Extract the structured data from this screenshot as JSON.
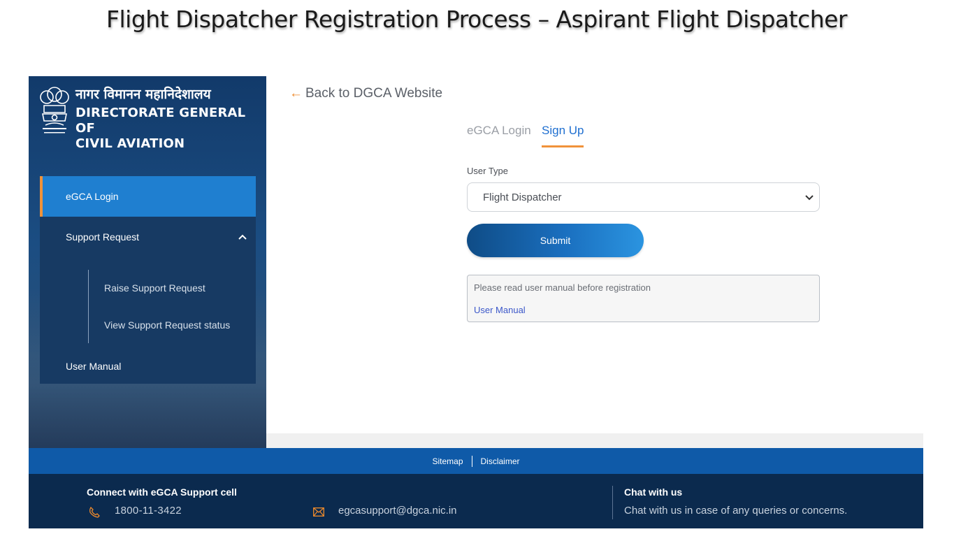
{
  "slide": {
    "title": "Flight Dispatcher Registration Process – Aspirant Flight Dispatcher"
  },
  "brand": {
    "hindi": "नागर विमानन महानिदेशालय",
    "english_line1": "DIRECTORATE GENERAL OF",
    "english_line2": "CIVIL AVIATION"
  },
  "sidebar": {
    "items": [
      {
        "label": "eGCA Login",
        "active": true
      },
      {
        "label": "Support Request",
        "expanded": true
      },
      {
        "label": "Raise Support Request"
      },
      {
        "label": "View Support Request status"
      },
      {
        "label": "User Manual"
      }
    ]
  },
  "main": {
    "back_link": "Back to DGCA Website",
    "tabs": [
      {
        "label": "eGCA Login",
        "active": false
      },
      {
        "label": "Sign Up",
        "active": true
      }
    ],
    "user_type_label": "User Type",
    "user_type_value": "Flight Dispatcher",
    "submit_label": "Submit",
    "notice_text": "Please read user manual before registration",
    "notice_link": "User Manual"
  },
  "footer": {
    "links": [
      "Sitemap",
      "Disclaimer"
    ],
    "connect_title": "Connect with eGCA Support cell",
    "phone": "1800-11-3422",
    "email": "egcasupport@dgca.nic.in",
    "chat_title": "Chat with us",
    "chat_text": "Chat with us in case of any queries or concerns."
  },
  "colors": {
    "accent_orange": "#f0923a",
    "primary_blue": "#1f7fd0",
    "footer_navy": "#0b2a4e"
  }
}
